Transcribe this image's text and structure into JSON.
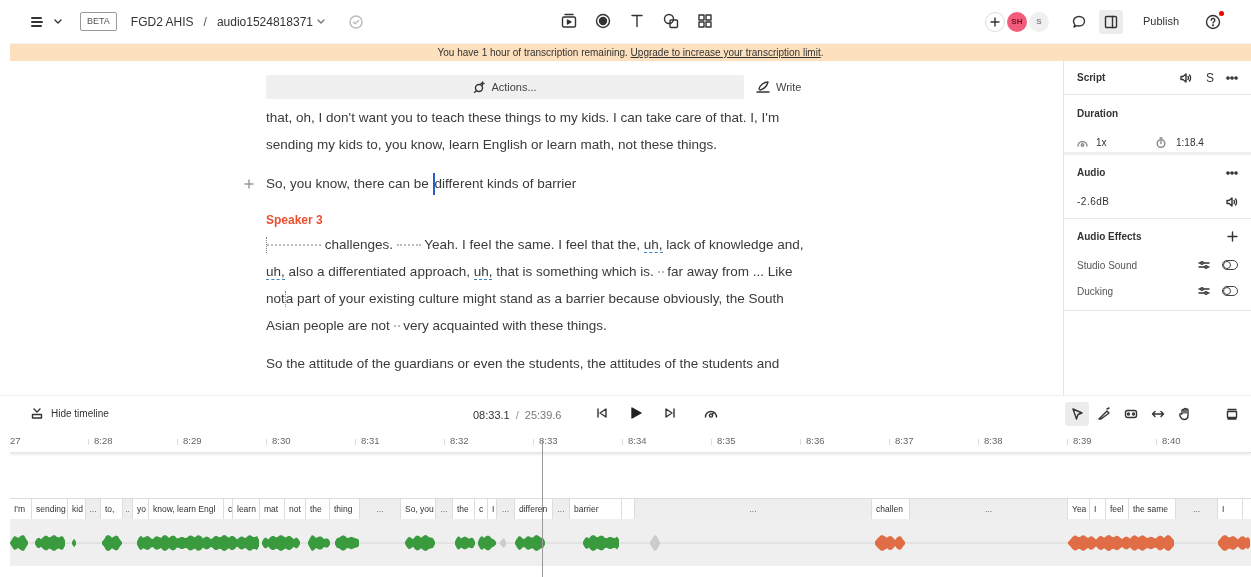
{
  "toolbar": {
    "beta_badge": "BETA",
    "project": "FGD2 AHIS",
    "separator": "/",
    "file": "audio1524818371",
    "avatars": [
      {
        "initials": "SH",
        "color": "#f25c7a"
      },
      {
        "initials": "S",
        "color": "#f0f0f0"
      }
    ],
    "publish": "Publish",
    "panel_toggle_selected": true,
    "help_notification": true
  },
  "banner": {
    "text": "You have 1 hour of transcription remaining. ",
    "link": "Upgrade to increase your transcription limit",
    "end": "."
  },
  "editor": {
    "actions": "Actions...",
    "write": "Write",
    "paragraphs": [
      {
        "segments": [
          {
            "kind": "text",
            "text": "that, oh, I don't want you to teach these things to my kids. I can take care of that. I, I'm sending my kids to, you know, learn English or learn math, not these things."
          }
        ]
      },
      {
        "hover": true,
        "segments": [
          {
            "kind": "text",
            "text": "So, you know, there can be "
          },
          {
            "kind": "caret"
          },
          {
            "kind": "text",
            "text": "different kinds of barrier"
          }
        ]
      },
      {
        "speaker": "Speaker 3",
        "segments": [
          {
            "kind": "ghost_caret"
          },
          {
            "kind": "pause_long"
          },
          {
            "kind": "text",
            "text": " challenges. "
          },
          {
            "kind": "pause"
          },
          {
            "kind": "text",
            "text": " Yeah. I feel the same. I feel that the, "
          },
          {
            "kind": "filler",
            "text": "uh,"
          },
          {
            "kind": "text",
            "text": " lack of knowledge and, "
          },
          {
            "kind": "filler",
            "text": "uh,"
          },
          {
            "kind": "text",
            "text": " also a differentiated approach, "
          },
          {
            "kind": "filler",
            "text": "uh,"
          },
          {
            "kind": "text",
            "text": " that is something which is. "
          },
          {
            "kind": "pause_short"
          },
          {
            "kind": "text",
            "text": " far away from ... Like not"
          },
          {
            "kind": "ghost_caret"
          },
          {
            "kind": "text",
            "text": "a part of your existing culture might stand as a barrier because obviously, the South Asian people are not "
          },
          {
            "kind": "pause_short"
          },
          {
            "kind": "text",
            "text": " very acquainted with these things."
          }
        ]
      },
      {
        "segments": [
          {
            "kind": "text",
            "text": "So the attitude of the guardians or even the students, the attitudes of the students and"
          }
        ]
      }
    ]
  },
  "panel": {
    "script": {
      "title": "Script",
      "speaker_initial": "S"
    },
    "duration": {
      "title": "Duration",
      "speed": "1x",
      "length": "1:18.4"
    },
    "audio": {
      "title": "Audio",
      "gain": "-2.6dB"
    },
    "effects": {
      "title": "Audio Effects",
      "items": [
        {
          "name": "Studio Sound",
          "on": false
        },
        {
          "name": "Ducking",
          "on": false
        }
      ]
    }
  },
  "timeline": {
    "hide": "Hide timeline",
    "current": "08:33.1",
    "separator": "/",
    "total": "25:39.6",
    "tools": [
      {
        "kind": "pointer",
        "selected": true
      },
      {
        "kind": "blade",
        "selected": false
      },
      {
        "kind": "clip",
        "selected": false
      },
      {
        "kind": "stretch",
        "selected": false
      },
      {
        "kind": "hand",
        "selected": false
      }
    ],
    "ticks": [
      "27",
      "8:28",
      "8:29",
      "8:30",
      "8:31",
      "8:32",
      "8:33",
      "8:34",
      "8:35",
      "8:36",
      "8:37",
      "8:38",
      "8:39",
      "8:40"
    ],
    "chips": [
      {
        "kind": "word",
        "text": "I'm"
      },
      {
        "kind": "word",
        "text": "sending"
      },
      {
        "kind": "word",
        "text": "kid"
      },
      {
        "kind": "gap",
        "text": "..."
      },
      {
        "kind": "word",
        "text": "to,"
      },
      {
        "kind": "gap",
        "text": ".."
      },
      {
        "kind": "word",
        "text": "yo"
      },
      {
        "kind": "word",
        "text": "know, learn Engl"
      },
      {
        "kind": "word",
        "text": "c"
      },
      {
        "kind": "word",
        "text": "learn"
      },
      {
        "kind": "word",
        "text": "mat"
      },
      {
        "kind": "word",
        "text": "not"
      },
      {
        "kind": "word",
        "text": "the"
      },
      {
        "kind": "word",
        "text": "thing"
      },
      {
        "kind": "gap",
        "text": "..."
      },
      {
        "kind": "word",
        "text": "So, you"
      },
      {
        "kind": "gap",
        "text": "..."
      },
      {
        "kind": "word",
        "text": "the"
      },
      {
        "kind": "word",
        "text": "c"
      },
      {
        "kind": "word",
        "text": "I"
      },
      {
        "kind": "gap",
        "text": "..."
      },
      {
        "kind": "word",
        "text": "differen"
      },
      {
        "kind": "gap",
        "text": "..."
      },
      {
        "kind": "word",
        "text": "barrier"
      },
      {
        "kind": "blank"
      },
      {
        "kind": "gap",
        "text": "..."
      },
      {
        "kind": "word",
        "text": "challen"
      },
      {
        "kind": "gap",
        "text": "..."
      },
      {
        "kind": "word",
        "text": "Yea"
      },
      {
        "kind": "word",
        "text": "I"
      },
      {
        "kind": "word",
        "text": "feel"
      },
      {
        "kind": "word",
        "text": "the same"
      },
      {
        "kind": "gap",
        "text": "..."
      },
      {
        "kind": "word",
        "text": "I"
      }
    ]
  }
}
